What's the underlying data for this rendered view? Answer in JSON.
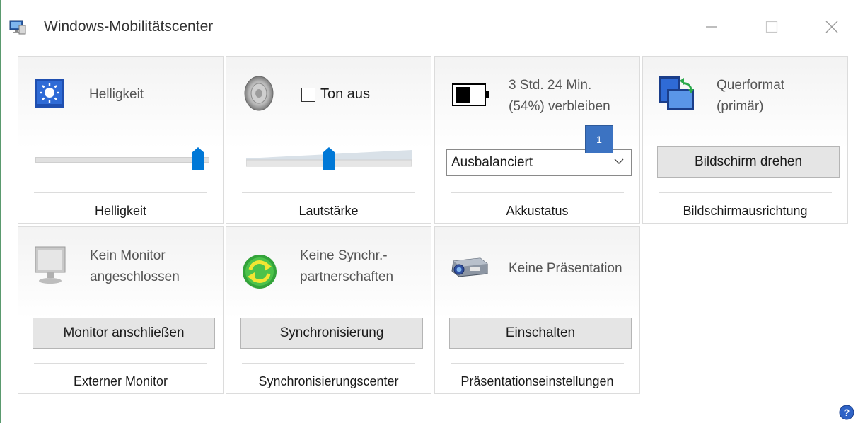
{
  "window": {
    "title": "Windows-Mobilitätscenter"
  },
  "tiles": {
    "brightness": {
      "text": "Helligkeit",
      "footer": "Helligkeit",
      "level": 0.97
    },
    "volume": {
      "mute_label": "Ton aus",
      "muted": false,
      "footer": "Lautstärke",
      "level": 0.5
    },
    "battery": {
      "line1": "3 Std. 24 Min.",
      "line2": "(54%) verbleiben",
      "percent": 54,
      "plan_selected": "Ausbalanciert",
      "badge": "1",
      "footer": "Akkustatus"
    },
    "orientation": {
      "line1": "Querformat",
      "line2": "(primär)",
      "button": "Bildschirm drehen",
      "footer": "Bildschirmausrichtung"
    },
    "monitor": {
      "line1": "Kein Monitor",
      "line2": "angeschlossen",
      "button": "Monitor anschließen",
      "footer": "Externer Monitor"
    },
    "sync": {
      "line1": "Keine Synchr.-",
      "line2": "partnerschaften",
      "button": "Synchronisierung",
      "footer": "Synchronisierungscenter"
    },
    "presentation": {
      "line1": "Keine Präsentation",
      "button": "Einschalten",
      "footer": "Präsentationseinstellungen"
    }
  },
  "icons": {
    "app": "mobility-center-icon",
    "brightness": "brightness-sun-icon",
    "volume": "speaker-icon",
    "battery": "battery-icon",
    "orientation": "screen-rotation-icon",
    "monitor": "monitor-icon",
    "sync": "sync-arrows-icon",
    "presentation": "projector-icon",
    "help": "help-icon"
  },
  "colors": {
    "accent": "#0078d7",
    "badge": "#3c73c2",
    "tile_border": "#dcdcdc",
    "button_bg": "#e5e5e5"
  }
}
